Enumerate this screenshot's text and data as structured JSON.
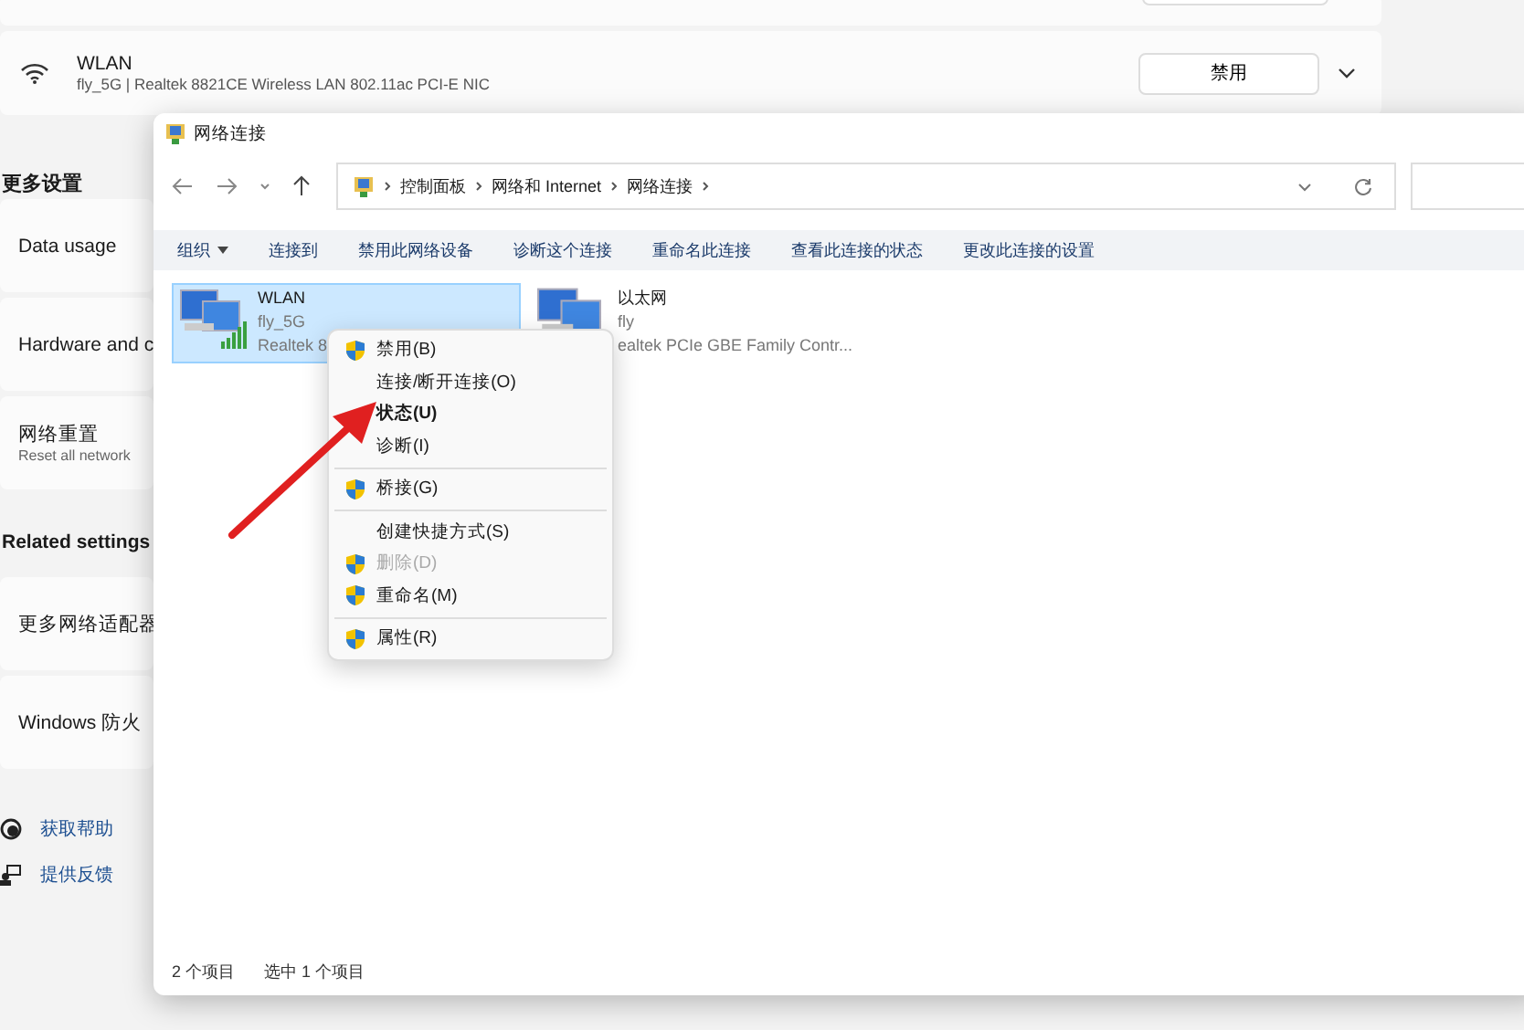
{
  "settings": {
    "wlan_adapter": {
      "name": "WLAN",
      "detail": "fly_5G | Realtek 8821CE Wireless LAN 802.11ac PCI-E NIC",
      "button": "禁用"
    },
    "section_title": "更多设置",
    "items": [
      {
        "title": "Data usage"
      },
      {
        "title": "Hardware and c"
      },
      {
        "title": "网络重置",
        "subtitle": "Reset all network"
      }
    ],
    "related_title": "Related settings",
    "related_items": [
      {
        "title": "更多网络适配器"
      },
      {
        "title": "Windows 防火"
      }
    ],
    "help_links": [
      {
        "kind": "help",
        "label": "获取帮助"
      },
      {
        "kind": "feedback",
        "label": "提供反馈"
      }
    ]
  },
  "explorer": {
    "title": "网络连接",
    "breadcrumb": [
      "控制面板",
      "网络和 Internet",
      "网络连接"
    ],
    "toolbar": [
      {
        "label": "组织",
        "menu": true
      },
      {
        "label": "连接到",
        "menu": false
      },
      {
        "label": "禁用此网络设备",
        "menu": false
      },
      {
        "label": "诊断这个连接",
        "menu": false
      },
      {
        "label": "重命名此连接",
        "menu": false
      },
      {
        "label": "查看此连接的状态",
        "menu": false
      },
      {
        "label": "更改此连接的设置",
        "menu": false
      }
    ],
    "items": [
      {
        "kind": "wifi",
        "name": "WLAN",
        "line2": "fly_5G",
        "line3": "Realtek 8",
        "selected": true
      },
      {
        "kind": "ethernet",
        "name": "以太网",
        "line2": "fly",
        "line3": "ealtek PCIe GBE Family Contr...",
        "selected": false
      }
    ],
    "status": [
      "2 个项目",
      "选中 1 个项目"
    ]
  },
  "context_menu": [
    {
      "kind": "item",
      "label": "禁用(B)",
      "shield": true,
      "bold": false,
      "disabled": false
    },
    {
      "kind": "item",
      "label": "连接/断开连接(O)",
      "shield": false,
      "bold": false,
      "disabled": false
    },
    {
      "kind": "item",
      "label": "状态(U)",
      "shield": false,
      "bold": true,
      "disabled": false
    },
    {
      "kind": "item",
      "label": "诊断(I)",
      "shield": false,
      "bold": false,
      "disabled": false
    },
    {
      "kind": "separator"
    },
    {
      "kind": "item",
      "label": "桥接(G)",
      "shield": true,
      "bold": false,
      "disabled": false
    },
    {
      "kind": "separator"
    },
    {
      "kind": "item",
      "label": "创建快捷方式(S)",
      "shield": false,
      "bold": false,
      "disabled": false
    },
    {
      "kind": "item",
      "label": "删除(D)",
      "shield": true,
      "bold": false,
      "disabled": true
    },
    {
      "kind": "item",
      "label": "重命名(M)",
      "shield": true,
      "bold": false,
      "disabled": false
    },
    {
      "kind": "separator"
    },
    {
      "kind": "item",
      "label": "属性(R)",
      "shield": true,
      "bold": false,
      "disabled": false
    }
  ]
}
